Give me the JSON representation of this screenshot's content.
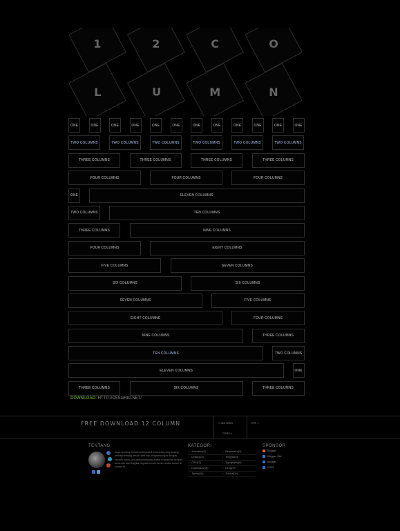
{
  "title_tiles": {
    "row1": [
      "1",
      "2",
      "C",
      "O"
    ],
    "row2": [
      "L",
      "U",
      "M",
      "N"
    ]
  },
  "grid_rows": [
    [
      "ONE",
      "ONE",
      "ONE",
      "ONE",
      "ONE",
      "ONE",
      "ONE",
      "ONE",
      "ONE",
      "ONE",
      "ONE",
      "ONE"
    ],
    [
      "TWO COLUMNS",
      "TWO COLUMNS",
      "TWO COLUMNS",
      "TWO COLUMNS",
      "TWO COLUMNS",
      "TWO COLUMNS"
    ],
    [
      "THREE COLUMNS",
      "THREE COLUMNS",
      "THREE COLUMNS",
      "THREE COLUMNS"
    ],
    [
      "FOUR COLUMNS",
      "FOUR COLUMNS",
      "FOUR COLUMNS"
    ],
    [
      "ONE",
      "ELEVEN COLUMNS"
    ],
    [
      "TWO COLUMNS",
      "TEN COLUMNS"
    ],
    [
      "THREE COLUMNS",
      "NINE COLUMNS"
    ],
    [
      "FOUR COLUMNS",
      "EIGHT COLUMNS"
    ],
    [
      "FIVE COLUMNS",
      "SEVEN COLUMNS"
    ],
    [
      "SIX COLUMNS",
      "SIX COLUMNS"
    ],
    [
      "SEVEN COLUMNS",
      "FIVE COLUMNS"
    ],
    [
      "EIGHT COLUMNS",
      "FOUR COLUMNS"
    ],
    [
      "NINE COLUMNS",
      "THREE COLUMNS"
    ],
    [
      "TEN COLUMNS",
      "TWO COLUMNS"
    ],
    [
      "ELEVEN COLUMNS",
      "ONE"
    ],
    [
      "THREE COLUMNS",
      "SIX COLUMNS",
      "THREE COLUMNS"
    ]
  ],
  "download": {
    "label": "DOWNLOAD:",
    "url": "HTTP://CSSGRID.NET/"
  },
  "footer_bar": {
    "free_download": "FREE DOWNLOAD 12 COLUMN",
    "left_link": "« 960 GRID",
    "right_link": "RTL »",
    "small_link": "CSS3 »"
  },
  "about": {
    "heading": "TENTANG",
    "text": "Saya seorang penulis web lokal di Indonesia yang senang berbagi tentang desain web dan pengembangan dengan seluruh dunia. Jika Anda menyukai artikel ini silahkan berikan komentar atau bagikan kepada teman Anda melalui tautan di bawah ini."
  },
  "categories": {
    "heading": "KATEGORI",
    "col1": [
      "Animation(8)",
      "Design(23)",
      "CSS(12)",
      "Downloads(16)",
      "Jquery(18)"
    ],
    "col2": [
      "Responsive(9)",
      "Template(4)",
      "Typography(6)",
      "Design(7)",
      "Tutorial(11)"
    ]
  },
  "sponsor": {
    "heading": "SPONSOR",
    "items": [
      "Blogger",
      "Blogger Site",
      "Blogger",
      "CSS3"
    ],
    "item_colors": [
      "#d86a1c",
      "#3a6fbf",
      "#3a6fbf",
      "#3a6fbf"
    ]
  }
}
